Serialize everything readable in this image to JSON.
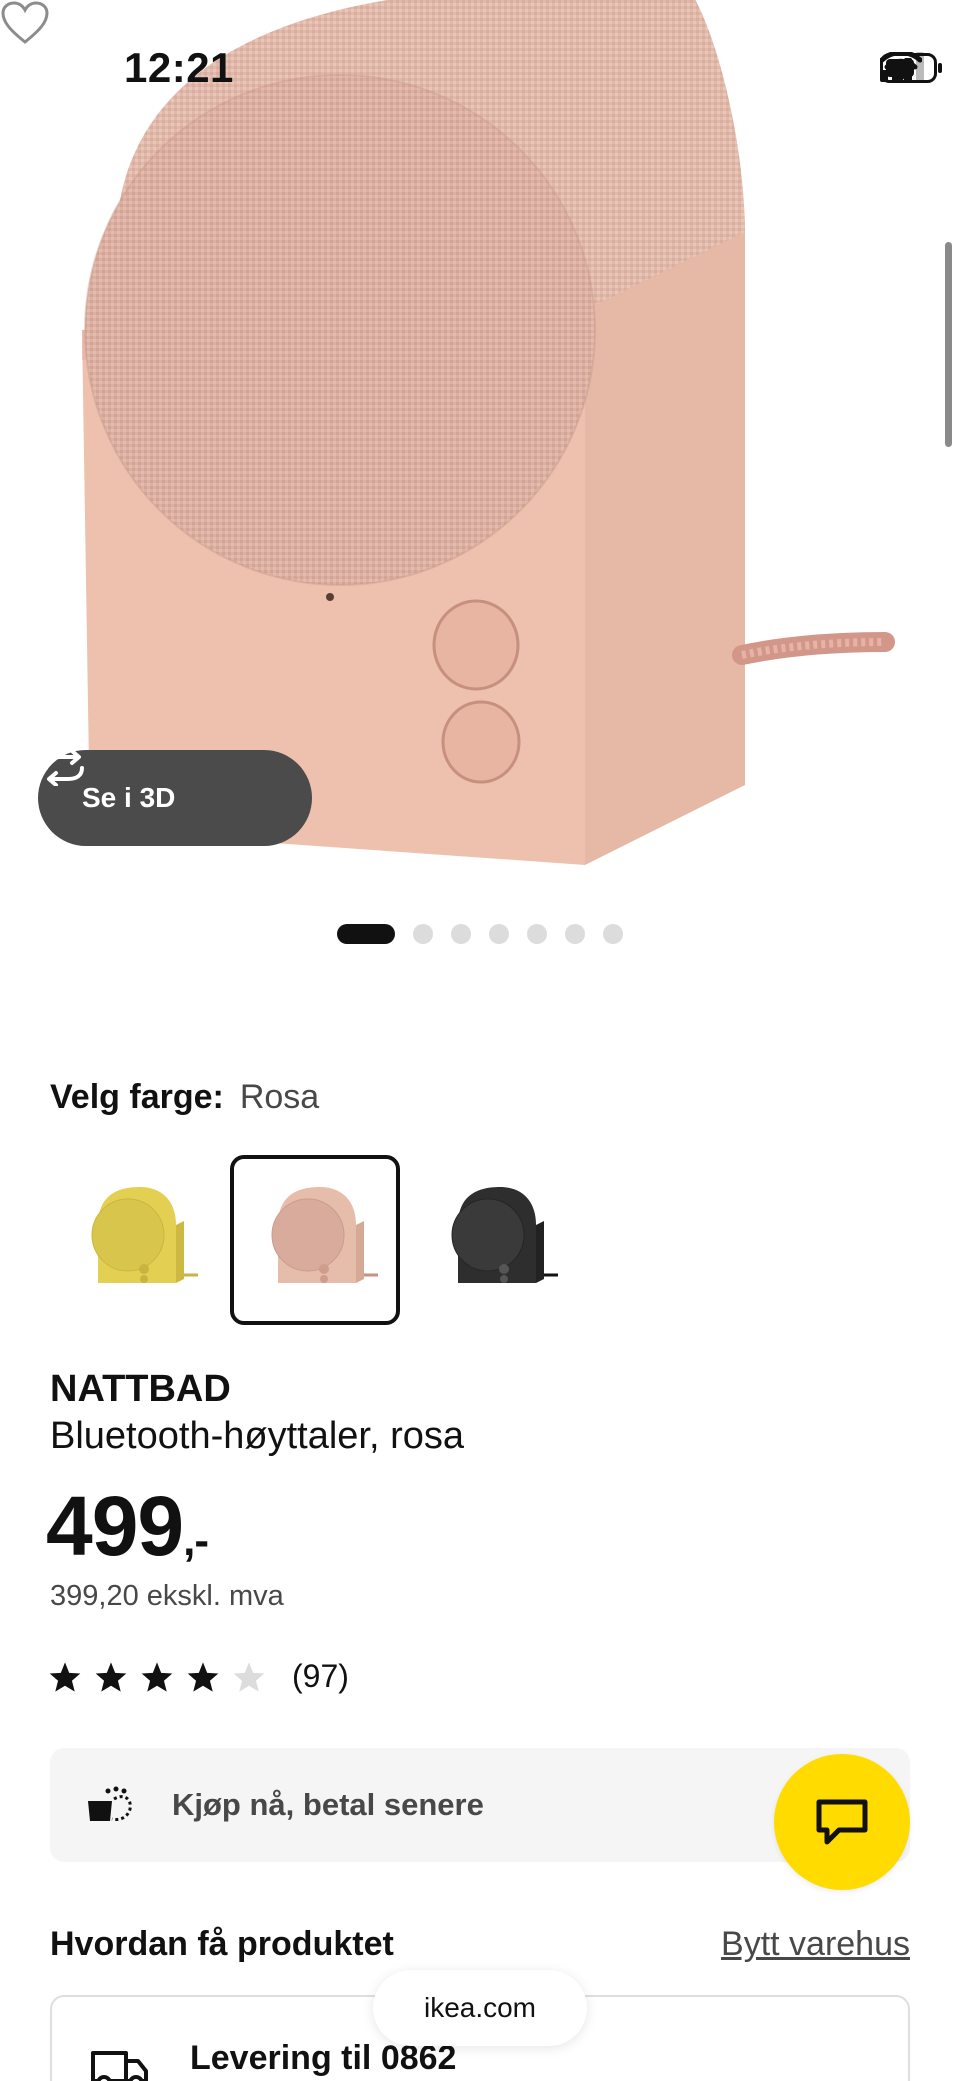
{
  "status_bar": {
    "time": "12:21"
  },
  "hero": {
    "see_3d_label": "Se i 3D",
    "carousel": {
      "total": 7,
      "active_index": 0
    }
  },
  "color_picker": {
    "label": "Velg farge:",
    "selected_value": "Rosa",
    "options": [
      {
        "name": "yellow",
        "color": "#e8d55a",
        "selected": false
      },
      {
        "name": "rosa",
        "color": "#e2b8a6",
        "selected": true
      },
      {
        "name": "black",
        "color": "#2c2c2c",
        "selected": false
      }
    ]
  },
  "product": {
    "name": "NATTBAD",
    "description": "Bluetooth-høyttaler, rosa",
    "price": "499",
    "price_suffix": ",-",
    "price_excl_vat": "399,20 ekskl. mva",
    "rating": 4,
    "rating_max": 5,
    "review_count": "(97)"
  },
  "financing": {
    "label": "Kjøp nå, betal senere"
  },
  "availability": {
    "title": "Hvordan få produktet",
    "switch_store_label": "Bytt varehus",
    "delivery_label": "Levering til 0862"
  },
  "browser": {
    "url": "ikea.com"
  },
  "colors": {
    "accent_yellow": "#ffdb00",
    "speaker_pink": "#e2b8a6",
    "text_dark": "#111111",
    "text_muted": "#484848"
  },
  "icons": {
    "heart": "heart-icon",
    "rotate": "rotate-3d-icon",
    "financing": "installment-icon",
    "chat": "chat-icon",
    "truck": "truck-icon"
  }
}
